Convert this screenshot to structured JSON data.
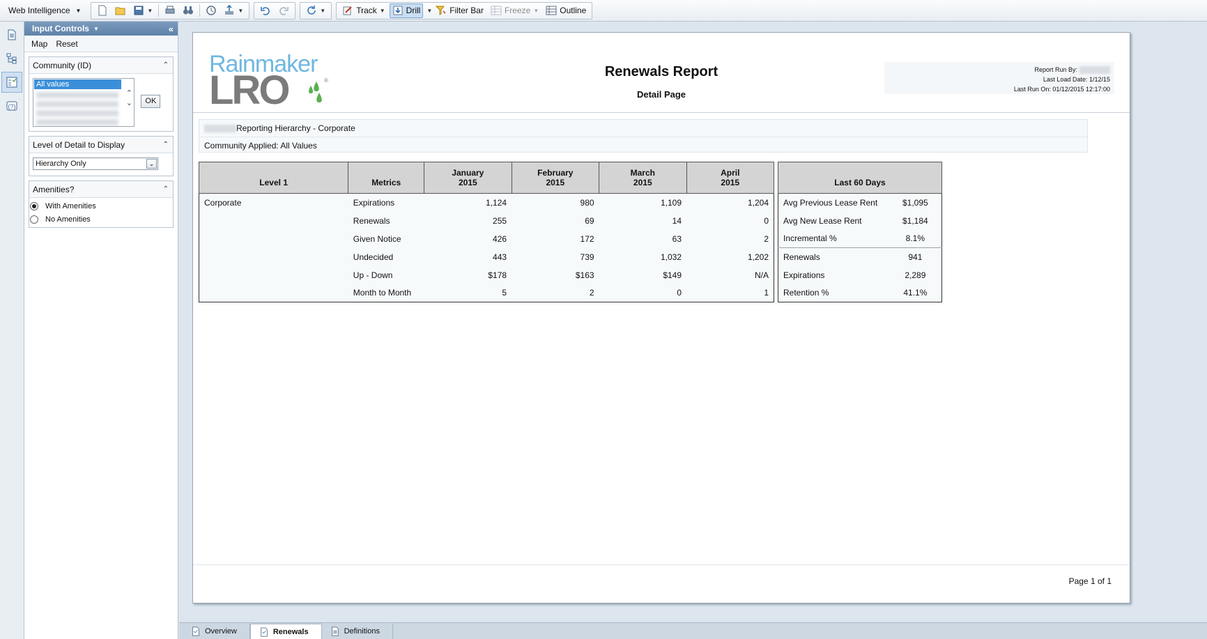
{
  "toolbar": {
    "app_name": "Web Intelligence",
    "track_label": "Track",
    "drill_label": "Drill",
    "filter_bar_label": "Filter Bar",
    "freeze_label": "Freeze",
    "outline_label": "Outline"
  },
  "panel": {
    "title": "Input Controls",
    "links": {
      "map": "Map",
      "reset": "Reset"
    },
    "community": {
      "title": "Community (ID)",
      "selected": "All values",
      "ok_label": "OK"
    },
    "level_detail": {
      "title": "Level of Detail to Display",
      "value": "Hierarchy Only"
    },
    "amenities": {
      "title": "Amenities?",
      "options": [
        "With Amenities",
        "No Amenities"
      ],
      "selected": "With Amenities"
    }
  },
  "report": {
    "logo_top": "Rainmaker",
    "logo_bottom": "LRO",
    "logo_reg": "®",
    "title": "Renewals Report",
    "subtitle": "Detail Page",
    "run_by_label": "Report Run By:",
    "last_load": "Last Load Date: 1/12/15",
    "last_run": "Last Run On: 01/12/2015 12:17:00",
    "hierarchy_line": "Reporting Hierarchy - Corporate",
    "community_line": "Community Applied: All Values",
    "page_number": "Page 1 of 1"
  },
  "main_table": {
    "headers": [
      "Level 1",
      "Metrics",
      "January\n2015",
      "February\n2015",
      "March\n2015",
      "April\n2015"
    ],
    "level": "Corporate",
    "rows": [
      {
        "metric": "Expirations",
        "values": [
          "1,124",
          "980",
          "1,109",
          "1,204"
        ]
      },
      {
        "metric": "Renewals",
        "values": [
          "255",
          "69",
          "14",
          "0"
        ]
      },
      {
        "metric": "Given Notice",
        "values": [
          "426",
          "172",
          "63",
          "2"
        ]
      },
      {
        "metric": "Undecided",
        "values": [
          "443",
          "739",
          "1,032",
          "1,202"
        ]
      },
      {
        "metric": "Up - Down",
        "values": [
          "$178",
          "$163",
          "$149",
          "N/A"
        ]
      },
      {
        "metric": "Month to Month",
        "values": [
          "5",
          "2",
          "0",
          "1"
        ]
      }
    ]
  },
  "side_table": {
    "header": "Last 60 Days",
    "rows": [
      {
        "label": "Avg Previous Lease Rent",
        "value": "$1,095"
      },
      {
        "label": "Avg New Lease Rent",
        "value": "$1,184"
      },
      {
        "label": "Incremental %",
        "value": "8.1%"
      },
      {
        "label": "Renewals",
        "value": "941"
      },
      {
        "label": "Expirations",
        "value": "2,289"
      },
      {
        "label": "Retention %",
        "value": "41.1%"
      }
    ]
  },
  "tabs": [
    "Overview",
    "Renewals",
    "Definitions"
  ],
  "active_tab": "Renewals"
}
